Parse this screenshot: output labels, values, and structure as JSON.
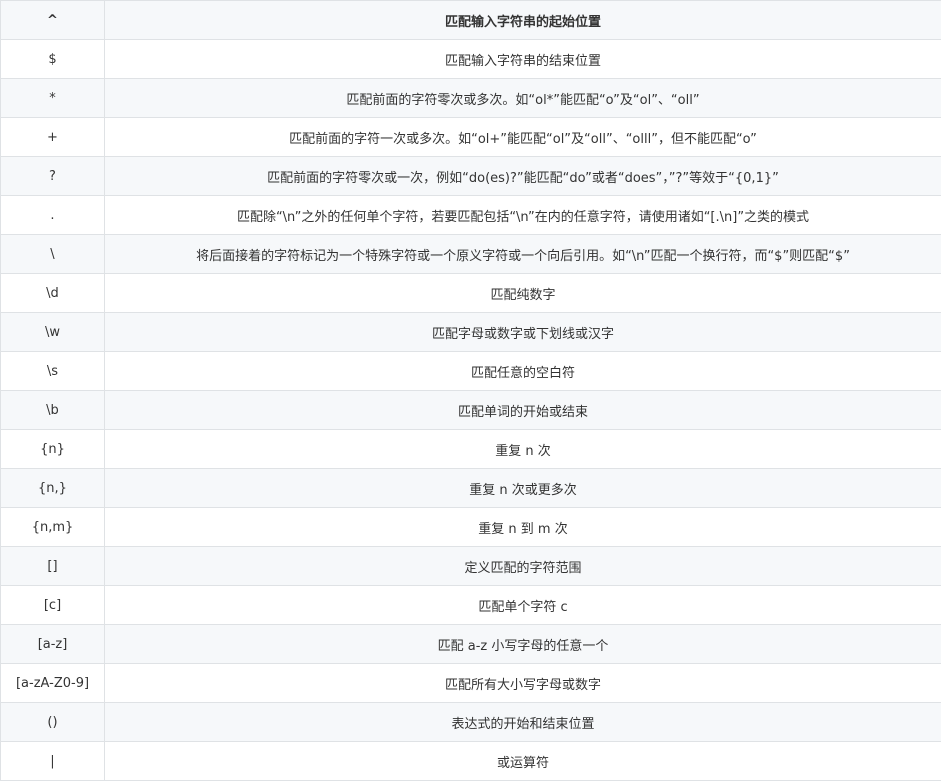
{
  "table": {
    "header": {
      "symbol": "^",
      "description": "匹配输入字符串的起始位置"
    },
    "rows": [
      {
        "symbol": "$",
        "description": "匹配输入字符串的结束位置"
      },
      {
        "symbol": "*",
        "description": "匹配前面的字符零次或多次。如“ol*”能匹配“o”及“ol”、“oll”"
      },
      {
        "symbol": "+",
        "description": "匹配前面的字符一次或多次。如“ol+”能匹配“ol”及“oll”、“olll”，但不能匹配“o”"
      },
      {
        "symbol": "?",
        "description": "匹配前面的字符零次或一次，例如“do(es)?”能匹配“do”或者“does”，”?”等效于“{0,1}”"
      },
      {
        "symbol": ".",
        "description": "匹配除“\\n”之外的任何单个字符，若要匹配包括“\\n”在内的任意字符，请使用诸如“[.\\n]”之类的模式"
      },
      {
        "symbol": "\\",
        "description": "将后面接着的字符标记为一个特殊字符或一个原义字符或一个向后引用。如“\\n”匹配一个换行符，而“$”则匹配“$”"
      },
      {
        "symbol": "\\d",
        "description": "匹配纯数字"
      },
      {
        "symbol": "\\w",
        "description": "匹配字母或数字或下划线或汉字"
      },
      {
        "symbol": "\\s",
        "description": "匹配任意的空白符"
      },
      {
        "symbol": "\\b",
        "description": "匹配单词的开始或结束"
      },
      {
        "symbol": "{n}",
        "description": "重复 n 次"
      },
      {
        "symbol": "{n,}",
        "description": "重复 n 次或更多次"
      },
      {
        "symbol": "{n,m}",
        "description": "重复 n 到 m 次"
      },
      {
        "symbol": "[]",
        "description": "定义匹配的字符范围"
      },
      {
        "symbol": "[c]",
        "description": "匹配单个字符 c"
      },
      {
        "symbol": "[a-z]",
        "description": "匹配 a-z 小写字母的任意一个"
      },
      {
        "symbol": "[a-zA-Z0-9]",
        "description": "匹配所有大小写字母或数字"
      },
      {
        "symbol": "()",
        "description": "表达式的开始和结束位置"
      },
      {
        "symbol": "|",
        "description": "或运算符"
      }
    ]
  }
}
